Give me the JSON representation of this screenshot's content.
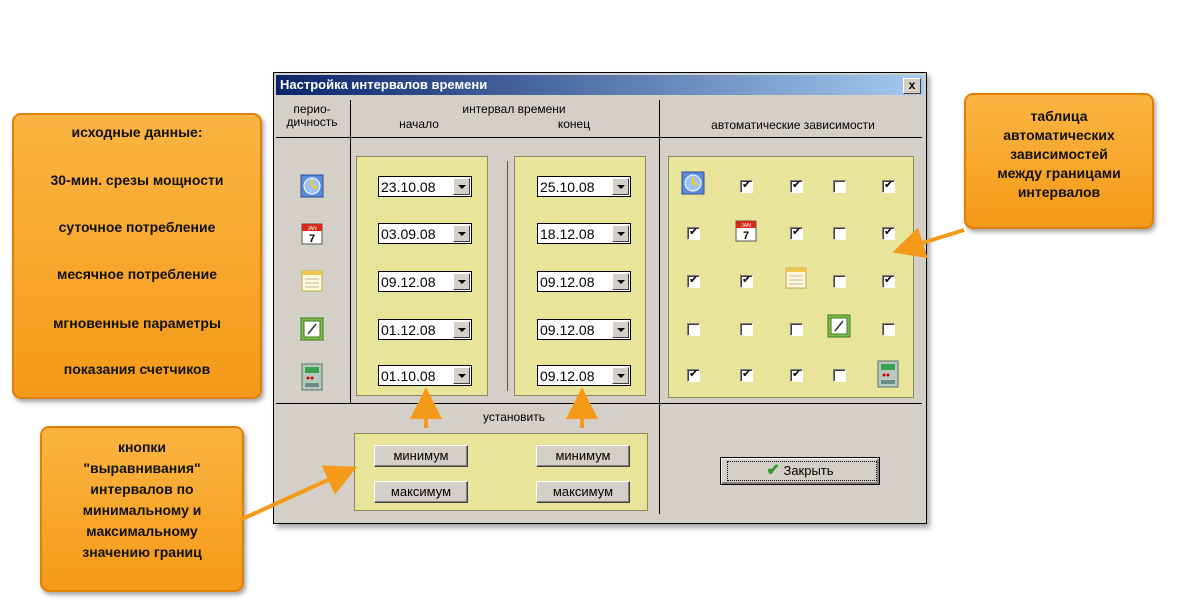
{
  "dialog": {
    "title": "Настройка интервалов времени",
    "close_symbol": "x",
    "header_period_line1": "перио-",
    "header_period_line2": "дичность",
    "header_interval": "интервал времени",
    "header_start": "начало",
    "header_end": "конец",
    "header_auto": "автоматические зависимости",
    "set_label": "установить",
    "min_button_left": "минимум",
    "min_button_right": "минимум",
    "max_button_left": "максимум",
    "max_button_right": "максимум",
    "close_button": "Закрыть",
    "start_dates": [
      "23.10.08",
      "03.09.08",
      "09.12.08",
      "01.12.08",
      "01.10.08"
    ],
    "end_dates": [
      "25.10.08",
      "18.12.08",
      "09.12.08",
      "09.12.08",
      "09.12.08"
    ],
    "period_icons": [
      "clock-icon",
      "calendar-icon",
      "month-sheet-icon",
      "gauge-icon",
      "meter-icon"
    ],
    "matrix": [
      [
        null,
        true,
        true,
        false,
        true
      ],
      [
        true,
        null,
        true,
        false,
        true
      ],
      [
        true,
        true,
        null,
        false,
        true
      ],
      [
        false,
        false,
        false,
        null,
        false
      ],
      [
        true,
        true,
        true,
        false,
        null
      ]
    ],
    "calendar_month": "JAN",
    "calendar_day": "7"
  },
  "callouts": {
    "source_data": "исходные данные:",
    "row1": "30-мин. срезы мощности",
    "row2": "суточное потребление",
    "row3": "месячное потребление",
    "row4": "мгновенные параметры",
    "row5": "показания счетчиков",
    "table_line1": "таблица",
    "table_line2": "автоматических",
    "table_line3": "зависимостей",
    "table_line4": "между границами",
    "table_line5": "интервалов",
    "buttons_line1": "кнопки",
    "buttons_line2": "\"выравнивания\"",
    "buttons_line3": "интервалов по",
    "buttons_line4": "минимальному и",
    "buttons_line5": "максимальному",
    "buttons_line6": "значению границ"
  },
  "colors": {
    "callout": "#f7a21f",
    "panel": "#e8e59b",
    "dialog_bg": "#d4d0c8",
    "title_start": "#0a246a",
    "title_end": "#a6caf0"
  }
}
